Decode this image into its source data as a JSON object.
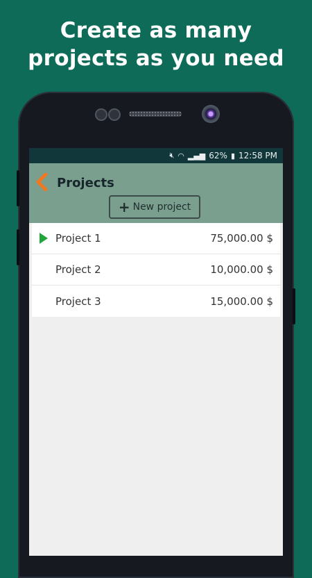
{
  "promo": {
    "line1": "Create as many",
    "line2": "projects as you need",
    "background_color": "#0d6b58"
  },
  "statusbar": {
    "battery": "62%",
    "time": "12:58 PM",
    "icons": [
      "mute-icon",
      "wifi-icon",
      "signal-icon",
      "battery-icon"
    ]
  },
  "appbar": {
    "title": "Projects",
    "back_icon": "chevron-left-icon",
    "new_project_label": "New project",
    "accent_color": "#f07820",
    "bar_color": "#7b9f8e"
  },
  "projects": [
    {
      "name": "Project 1",
      "amount": "75,000.00 $",
      "active": true
    },
    {
      "name": "Project 2",
      "amount": "10,000.00 $",
      "active": false
    },
    {
      "name": "Project 3",
      "amount": "15,000.00 $",
      "active": false
    }
  ]
}
